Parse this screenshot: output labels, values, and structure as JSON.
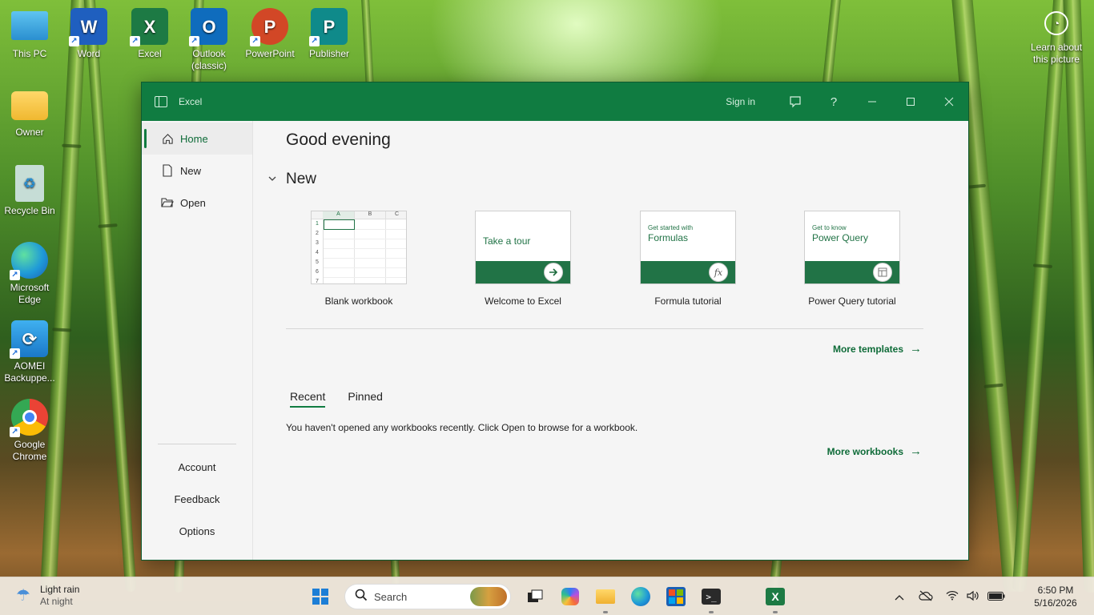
{
  "desktop": {
    "icons": [
      {
        "label": "This PC"
      },
      {
        "label": "Word"
      },
      {
        "label": "Excel"
      },
      {
        "label": "Outlook (classic)"
      },
      {
        "label": "PowerPoint"
      },
      {
        "label": "Publisher"
      },
      {
        "label": "Owner"
      },
      {
        "label": "Recycle Bin"
      },
      {
        "label": "Microsoft Edge"
      },
      {
        "label": "AOMEI Backuppe..."
      },
      {
        "label": "Google Chrome"
      }
    ],
    "learn_about": "Learn about this picture"
  },
  "window": {
    "app_title": "Excel",
    "sign_in": "Sign in",
    "help_glyph": "?"
  },
  "sidebar": {
    "items": [
      {
        "label": "Home"
      },
      {
        "label": "New"
      },
      {
        "label": "Open"
      }
    ],
    "bottom": [
      {
        "label": "Account"
      },
      {
        "label": "Feedback"
      },
      {
        "label": "Options"
      }
    ]
  },
  "main": {
    "greeting": "Good evening",
    "new_header": "New",
    "templates": [
      {
        "caption": "Blank workbook"
      },
      {
        "caption": "Welcome to Excel",
        "thumb_text": "Take a tour"
      },
      {
        "caption": "Formula tutorial",
        "thumb_small": "Get started with",
        "thumb_big": "Formulas",
        "glyph": "fx"
      },
      {
        "caption": "Power Query tutorial",
        "thumb_small": "Get to know",
        "thumb_big": "Power Query"
      }
    ],
    "grid_cols": [
      "A",
      "B",
      "C"
    ],
    "grid_rows": [
      "1",
      "2",
      "3",
      "4",
      "5",
      "6",
      "7"
    ],
    "more_templates": "More templates",
    "tabs": [
      {
        "label": "Recent"
      },
      {
        "label": "Pinned"
      }
    ],
    "empty_message": "You haven't opened any workbooks recently. Click Open to browse for a workbook.",
    "more_workbooks": "More workbooks"
  },
  "taskbar": {
    "weather": {
      "title": "Light rain",
      "subtitle": "At night"
    },
    "search_placeholder": "Search",
    "clock": {
      "time": "6:50 PM",
      "date": "5/16/2026"
    }
  },
  "colors": {
    "excel_green": "#107c41",
    "link_green": "#0e6b38"
  }
}
